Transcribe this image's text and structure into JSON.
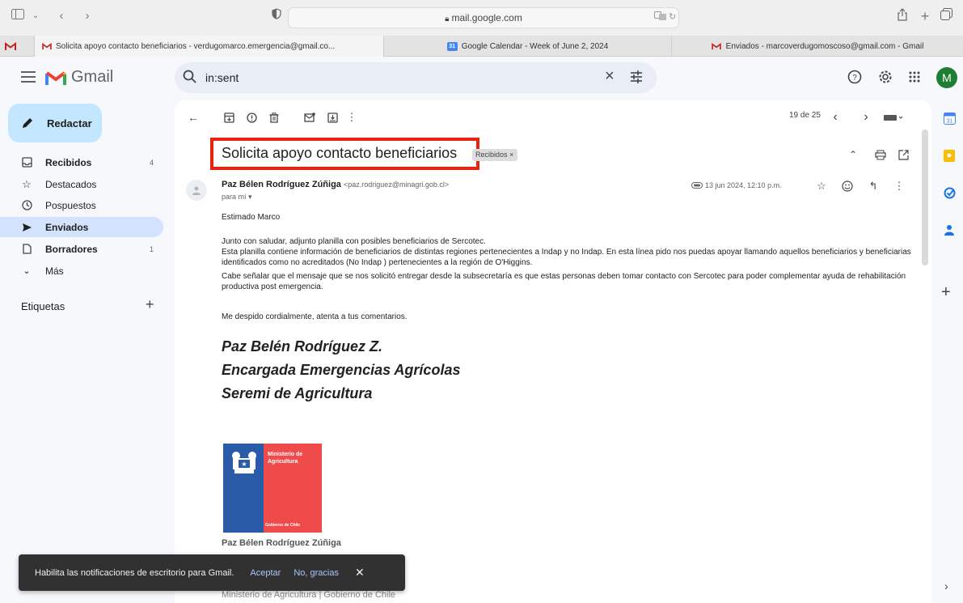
{
  "browser": {
    "url": "mail.google.com",
    "tabs": [
      {
        "label": "Solicita apoyo contacto beneficiarios - verdugomarco.emergencia@gmail.co..."
      },
      {
        "label": "Google Calendar - Week of June 2, 2024"
      },
      {
        "label": "Enviados - marcoverdugomoscoso@gmail.com - Gmail"
      }
    ]
  },
  "header": {
    "app_name": "Gmail",
    "search_value": "in:sent",
    "avatar_letter": "M"
  },
  "sidebar": {
    "compose_label": "Redactar",
    "items": [
      {
        "label": "Recibidos",
        "count": "4"
      },
      {
        "label": "Destacados",
        "count": ""
      },
      {
        "label": "Pospuestos",
        "count": ""
      },
      {
        "label": "Enviados",
        "count": ""
      },
      {
        "label": "Borradores",
        "count": "1"
      },
      {
        "label": "Más",
        "count": ""
      }
    ],
    "labels_title": "Etiquetas"
  },
  "toolbar": {
    "pager": "19 de 25"
  },
  "message": {
    "subject": "Solicita apoyo contacto beneficiarios",
    "label_chip": "Recibidos ×",
    "sender_name": "Paz Bélen Rodríguez Zúñiga",
    "sender_email": "<paz.rodriguez@minagri.gob.cl>",
    "to": "para mí ▾",
    "date": "13 jun 2024, 12:10 p.m.",
    "greeting": "Estimado Marco",
    "p1": "Junto con saludar, adjunto planilla con posibles beneficiarios de Sercotec.",
    "p2": "Esta planilla contiene información de beneficiarios de distintas regiones pertenecientes a Indap y no Indap. En esta línea pido nos puedas apoyar llamando aquellos beneficiarios y beneficiarias identificados como no acreditados (No Indap ) pertenecientes a la región de O'Higgins.",
    "p3": "Cabe señalar que el mensaje que se nos solicitó entregar desde la subsecretaría es que estas personas deben tomar contacto con Sercotec para poder complementar ayuda de rehabilitación productiva post emergencia.",
    "closing": "Me despido cordialmente, atenta a tus comentarios.",
    "sig1": "Paz Belén Rodríguez Z.",
    "sig2": "Encargada Emergencias Agrícolas",
    "sig3": "Seremi de Agricultura",
    "logo_text_1": "Ministerio de",
    "logo_text_2": "Agricultura",
    "logo_text_3": "Gobierno de Chile",
    "name_under_logo": "Paz Bélen Rodríguez Zúñiga",
    "partial_line": "Ministerio de Agricultura | Gobierno de Chile"
  },
  "snackbar": {
    "text": "Habilita las notificaciones de escritorio para Gmail.",
    "accept": "Aceptar",
    "decline": "No, gracias"
  },
  "colors": {
    "highlight_box": "#e8230f",
    "compose_bg": "#c2e7ff",
    "active_nav": "#d3e3fd"
  }
}
